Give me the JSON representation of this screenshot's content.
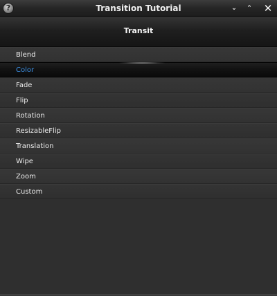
{
  "window": {
    "title": "Transition Tutorial",
    "help_glyph": "?",
    "buttons": {
      "minimize": "⌄",
      "maximize": "⌃",
      "close": "✕"
    }
  },
  "header": {
    "title": "Transit"
  },
  "list": {
    "selected_index": 1,
    "accent_color": "#3d92e8",
    "items": [
      {
        "label": "Blend"
      },
      {
        "label": "Color"
      },
      {
        "label": "Fade"
      },
      {
        "label": "Flip"
      },
      {
        "label": "Rotation"
      },
      {
        "label": "ResizableFlip"
      },
      {
        "label": "Translation"
      },
      {
        "label": "Wipe"
      },
      {
        "label": "Zoom"
      },
      {
        "label": "Custom"
      }
    ]
  }
}
